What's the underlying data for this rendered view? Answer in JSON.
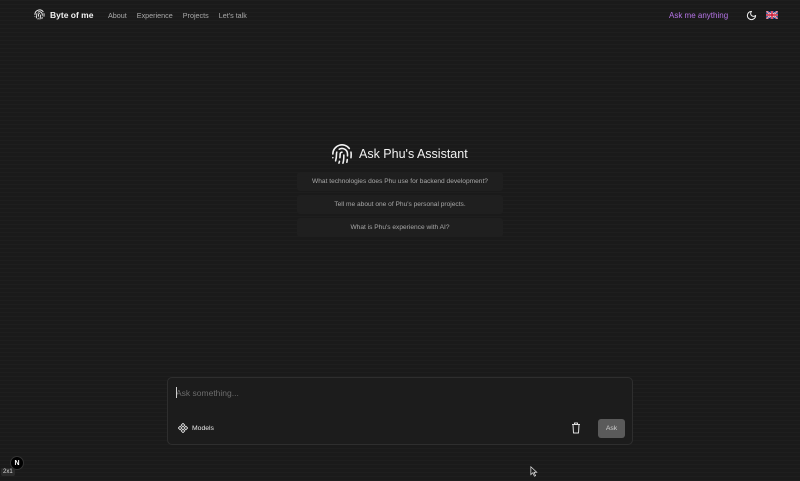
{
  "header": {
    "brand": "Byte of me",
    "nav": [
      "About",
      "Experience",
      "Projects",
      "Let's talk"
    ],
    "ask_anything": "Ask me anything",
    "icons": {
      "logo": "fingerprint-icon",
      "theme": "moon-icon",
      "language": "uk-flag-icon"
    }
  },
  "assistant": {
    "title": "Ask Phu's Assistant",
    "suggestions": [
      "What technologies does Phu use for backend development?",
      "Tell me about one of Phu's personal projects.",
      "What is Phu's experience with AI?"
    ]
  },
  "composer": {
    "placeholder": "Ask something...",
    "value": "",
    "models_label": "Models",
    "ask_label": "Ask"
  },
  "dev": {
    "badge": "N",
    "zoom": "2x1"
  },
  "colors": {
    "accent": "#b574e6",
    "background": "#1a1a1a",
    "surface": "#1f1f1f"
  }
}
